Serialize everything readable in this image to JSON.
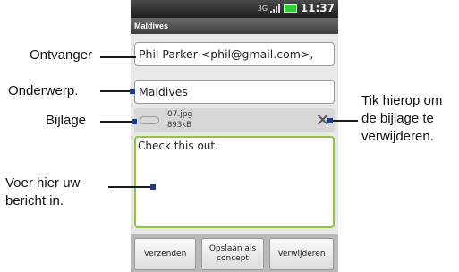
{
  "status": {
    "network": "3G",
    "time": "11:37"
  },
  "title": "Maldives",
  "to_value": "Phil Parker <phil@gmail.com>,",
  "subject_value": "Maldives",
  "attachment": {
    "filename": "07.jpg",
    "size": "893kB",
    "remove_symbol": "✕"
  },
  "body_text": "Check this out.",
  "buttons": {
    "send": "Verzenden",
    "save_draft": "Opslaan als concept",
    "delete": "Verwijderen"
  },
  "labels": {
    "recipient": "Ontvanger",
    "subject": "Onderwerp.",
    "attachment": "Bijlage",
    "message_line1": "Voer hier uw",
    "message_line2": "bericht in.",
    "remove_line1": "Tik hierop om",
    "remove_line2": "de bijlage te",
    "remove_line3": "verwijderen."
  }
}
